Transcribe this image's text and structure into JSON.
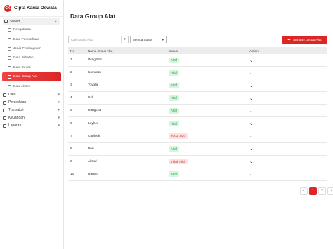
{
  "brand": {
    "name": "Cipta Karsa Dewata",
    "logo_text": "CK"
  },
  "sidebar": {
    "system_group": {
      "label": "Sistem"
    },
    "system_items": [
      {
        "label": "Pengaturan"
      },
      {
        "label": "Data Perusahaan"
      },
      {
        "label": "Jenis Pembayaran"
      },
      {
        "label": "Data Jabatan"
      },
      {
        "label": "Data Devisi"
      },
      {
        "label": "Data Group Alat"
      },
      {
        "label": "Data Akses"
      }
    ],
    "groups": [
      {
        "label": "Data"
      },
      {
        "label": "Persediaan"
      },
      {
        "label": "Transaksi"
      },
      {
        "label": "Keuangan"
      },
      {
        "label": "Laporan"
      }
    ]
  },
  "page": {
    "title": "Data Group Alat"
  },
  "toolbar": {
    "search_placeholder": "Cari Group Alat",
    "status_filter": "Semua Status",
    "add_button": "Tambah Group Alat"
  },
  "table": {
    "headers": [
      "No",
      "Nama Group Alat",
      "Status",
      "Action"
    ],
    "rows": [
      {
        "no": "1",
        "name": "Wing Nut",
        "status": "Aktif"
      },
      {
        "no": "2",
        "name": "Komatsu",
        "status": "Aktif"
      },
      {
        "no": "3",
        "name": "Toyota",
        "status": "Aktif"
      },
      {
        "no": "4",
        "name": "Heli",
        "status": "Aktif"
      },
      {
        "no": "5",
        "name": "Hangcha",
        "status": "Aktif"
      },
      {
        "no": "6",
        "name": "Layher",
        "status": "Aktif"
      },
      {
        "no": "7",
        "name": "Cuplock",
        "status": "Tidak Aktif"
      },
      {
        "no": "8",
        "name": "Peri",
        "status": "Aktif"
      },
      {
        "no": "9",
        "name": "Altrad",
        "status": "Tidak Aktif"
      },
      {
        "no": "10",
        "name": "Harsco",
        "status": "Aktif"
      }
    ]
  },
  "pagination": {
    "prev": "‹",
    "pages": [
      "1",
      "2"
    ],
    "next": "›",
    "current": "1"
  },
  "colors": {
    "accent": "#dc2626",
    "active_badge_bg": "#d7f5de",
    "inactive_badge_bg": "#fde0e0"
  }
}
